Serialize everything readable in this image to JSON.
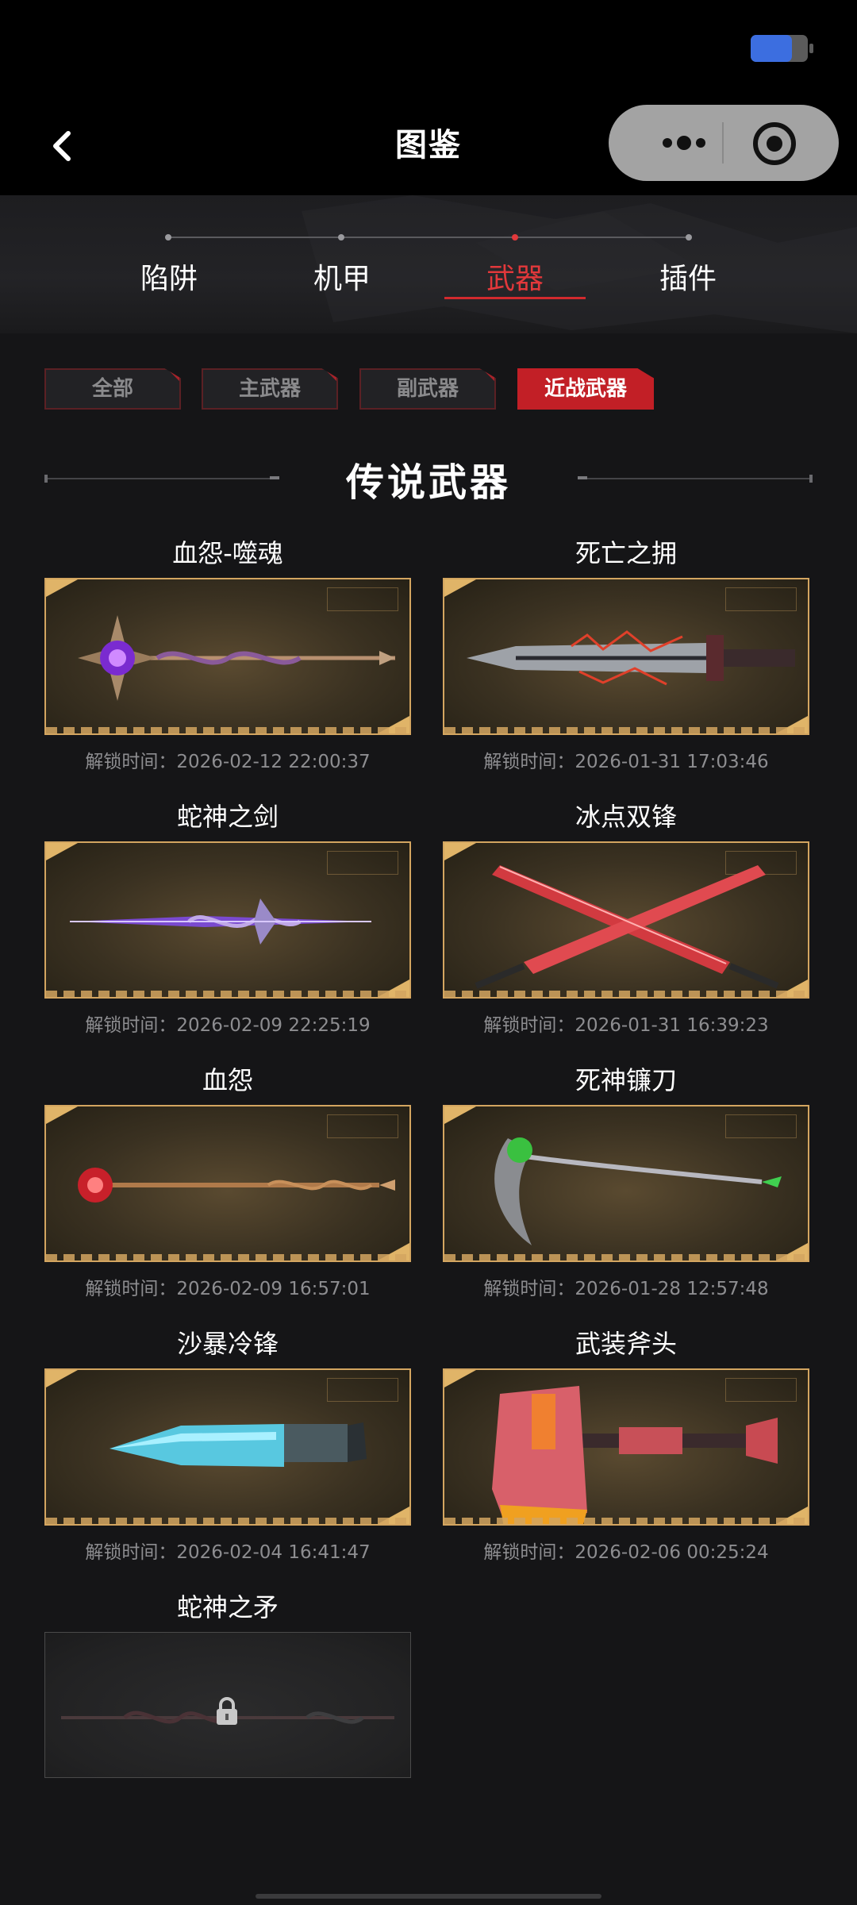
{
  "status_bar": {
    "battery_level": 0.72,
    "battery_color": "#3c6ee0"
  },
  "nav": {
    "title": "图鉴",
    "back_icon": "chevron-left-icon",
    "more_icon": "more-dots-icon",
    "close_icon": "target-icon"
  },
  "tabs": [
    {
      "label": "陷阱",
      "active": false
    },
    {
      "label": "机甲",
      "active": false
    },
    {
      "label": "武器",
      "active": true
    },
    {
      "label": "插件",
      "active": false
    }
  ],
  "filters": [
    {
      "label": "全部",
      "selected": false
    },
    {
      "label": "主武器",
      "selected": false
    },
    {
      "label": "副武器",
      "selected": false
    },
    {
      "label": "近战武器",
      "selected": true
    }
  ],
  "section": {
    "title": "传说武器"
  },
  "weapons": [
    {
      "name": "血怨-噬魂",
      "unlock": "解锁时间：2026-02-12 22:00:37",
      "locked": false
    },
    {
      "name": "死亡之拥",
      "unlock": "解锁时间：2026-01-31 17:03:46",
      "locked": false
    },
    {
      "name": "蛇神之剑",
      "unlock": "解锁时间：2026-02-09 22:25:19",
      "locked": false
    },
    {
      "name": "冰点双锋",
      "unlock": "解锁时间：2026-01-31 16:39:23",
      "locked": false
    },
    {
      "name": "血怨",
      "unlock": "解锁时间：2026-02-09 16:57:01",
      "locked": false
    },
    {
      "name": "死神镰刀",
      "unlock": "解锁时间：2026-01-28 12:57:48",
      "locked": false
    },
    {
      "name": "沙暴冷锋",
      "unlock": "解锁时间：2026-02-04 16:41:47",
      "locked": false
    },
    {
      "name": "武装斧头",
      "unlock": "解锁时间：2026-02-06 00:25:24",
      "locked": false
    },
    {
      "name": "蛇神之矛",
      "unlock": "",
      "locked": true
    }
  ],
  "colors": {
    "accent": "#e2383b",
    "gold": "#d3a560",
    "chip_active": "#c21f26"
  }
}
